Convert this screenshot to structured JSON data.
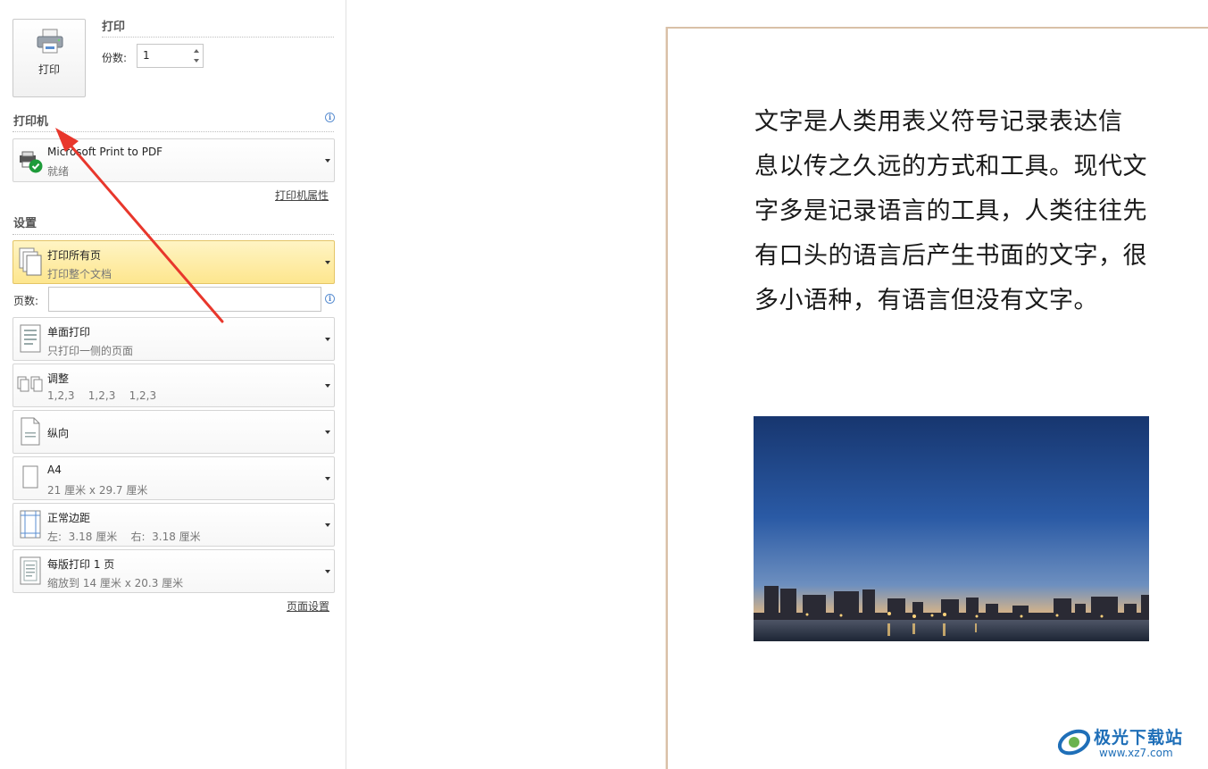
{
  "print": {
    "button_label": "打印",
    "section_title": "打印",
    "copies_label": "份数:",
    "copies_value": "1"
  },
  "printer": {
    "section_title": "打印机",
    "info_icon": "i",
    "name": "Microsoft Print to PDF",
    "status": "就绪",
    "properties_link": "打印机属性"
  },
  "settings": {
    "section_title": "设置",
    "pages_label": "页数:",
    "pages_value": "",
    "items": [
      {
        "title": "打印所有页",
        "subtitle": "打印整个文档",
        "icon": "pages-icon"
      },
      {
        "title": "单面打印",
        "subtitle": "只打印一侧的页面",
        "icon": "one-sided-icon"
      },
      {
        "title": "调整",
        "subtitle": "1,2,3    1,2,3    1,2,3",
        "icon": "collate-icon"
      },
      {
        "title": "纵向",
        "subtitle": "",
        "icon": "portrait-icon"
      },
      {
        "title": "A4",
        "subtitle": "21 厘米 x 29.7 厘米",
        "icon": "paper-size-icon"
      },
      {
        "title": "正常边距",
        "subtitle": "左:  3.18 厘米    右:  3.18 厘米",
        "icon": "margins-icon"
      },
      {
        "title": "每版打印 1 页",
        "subtitle": "缩放到 14 厘米 x 20.3 厘米",
        "icon": "pages-per-sheet-icon"
      }
    ],
    "page_setup_link": "页面设置"
  },
  "preview": {
    "lines": [
      "文字是人类用表义符号记录表达信",
      "息以传之久远的方式和工具。现代文",
      "字多是记录语言的工具，人类往往先",
      "有口头的语言后产生书面的文字，很",
      "多小语种，有语言但没有文字。"
    ],
    "photo": "city-skyline-night-photo"
  },
  "watermark": {
    "brand": "极光下载站",
    "url": "www.xz7.com"
  },
  "colors": {
    "highlight": "#fde68e",
    "arrow": "#e8372c",
    "link": "#444444",
    "watermark": "#1f6fb8"
  }
}
